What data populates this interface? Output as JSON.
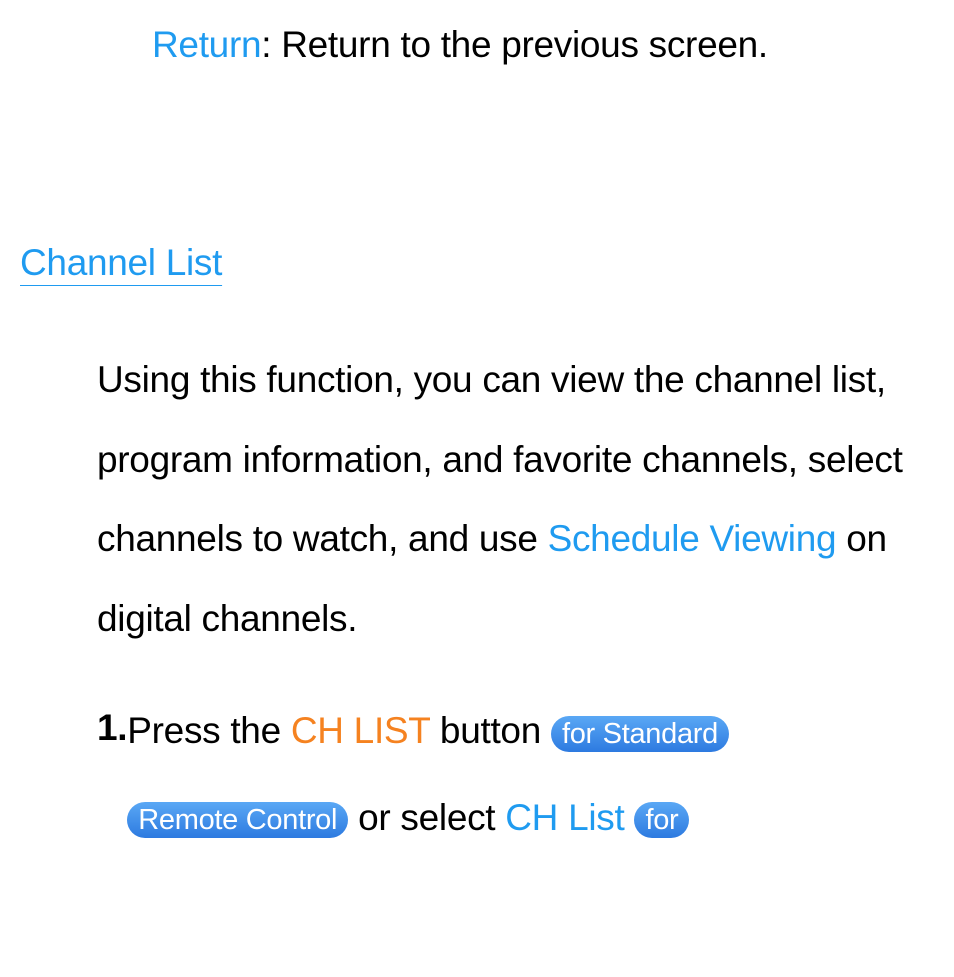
{
  "top": {
    "return_label": "Return",
    "return_desc": ": Return to the previous screen."
  },
  "heading": "Channel List",
  "intro": {
    "part1": "Using this function, you can view the channel list, program information, and favorite channels, select channels to watch, and use ",
    "schedule_viewing": "Schedule Viewing",
    "part2": " on digital channels."
  },
  "step": {
    "number": "1.",
    "press_the": "Press the ",
    "ch_list_btn": "CH LIST",
    "button_word": " button ",
    "pill_standard": "for Standard",
    "pill_remote": "Remote Control",
    "or_select": "  or select  ",
    "ch_list_link": "CH List",
    "pill_for": "for"
  }
}
